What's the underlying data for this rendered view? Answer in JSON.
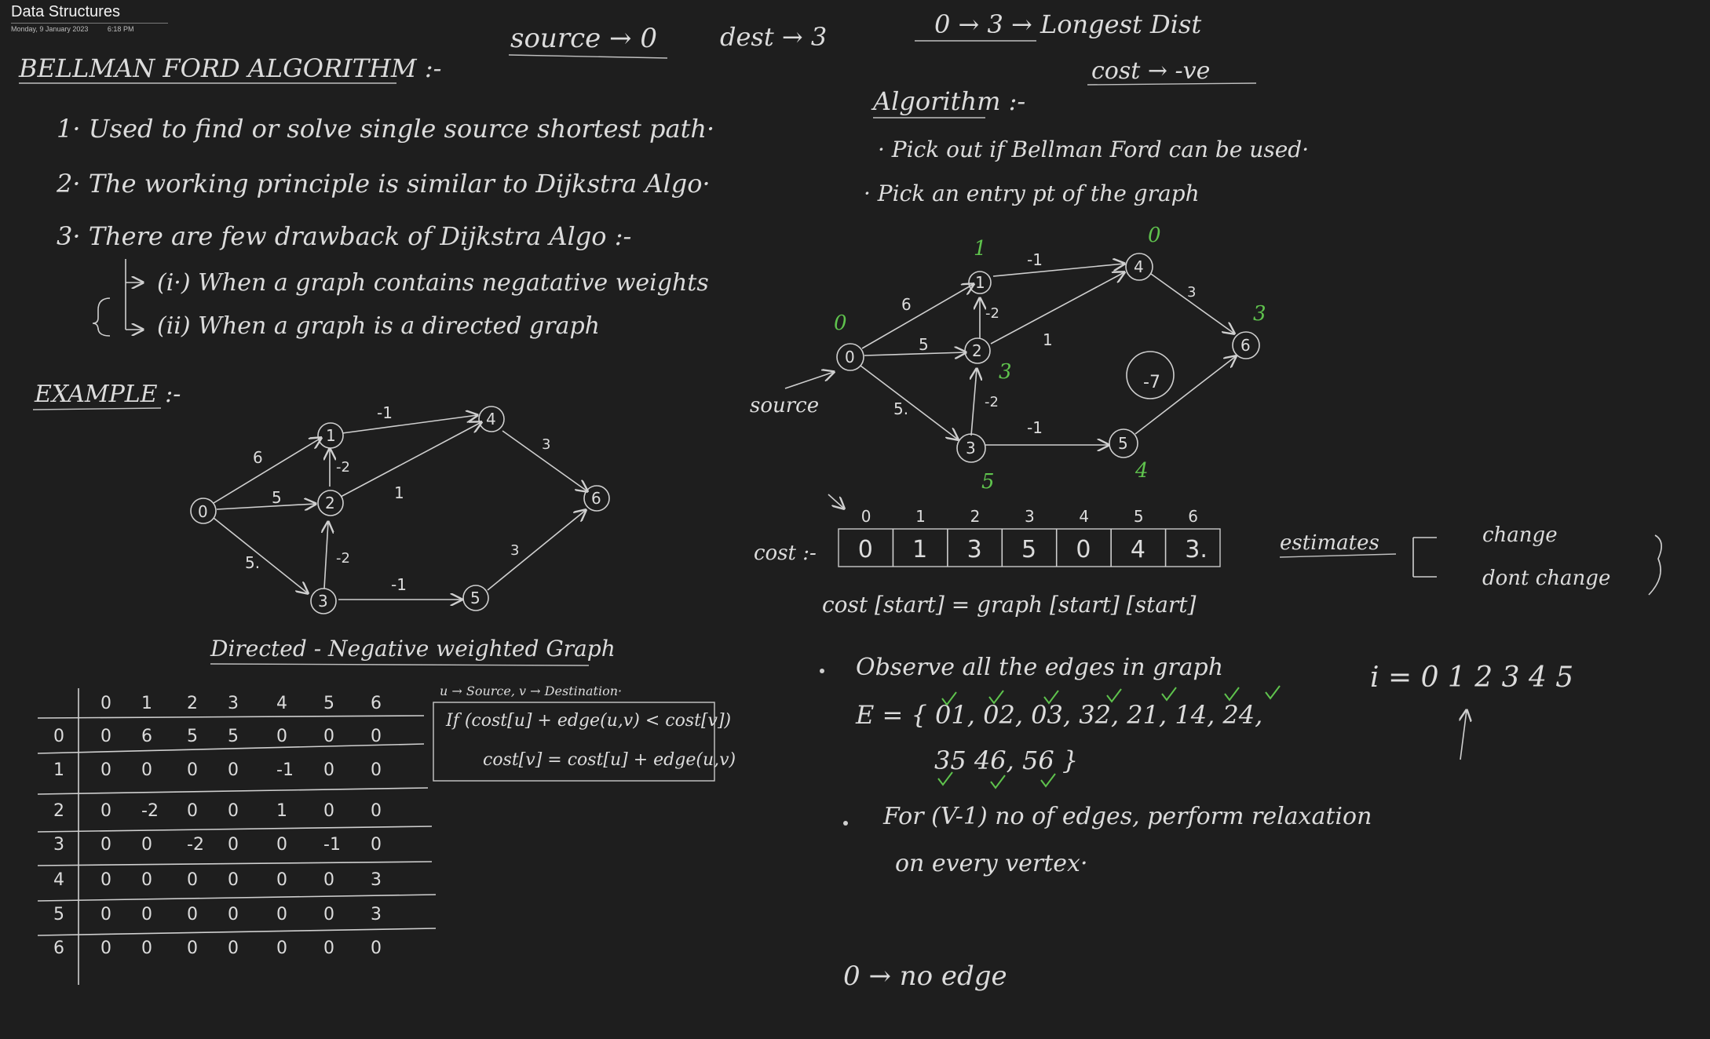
{
  "header": {
    "title": "Data Structures",
    "date": "Monday, 9 January 2023",
    "time": "6:18 PM"
  },
  "top": {
    "source": "source → 0",
    "dest": "dest → 3",
    "longest": "0 → 3 → Longest Dist",
    "cost": "cost → -ve"
  },
  "left": {
    "title": "BELLMAN FORD ALGORITHM :-",
    "points": [
      "1· Used to find or solve  single  source  shortest  path·",
      "2· The working principle  is  similar  to  Dijkstra  Algo·",
      "3· There  are  few  drawback  of  Dijkstra  Algo :-"
    ],
    "sub": [
      "(i·) When  a  graph  contains  negatative  weights",
      "(ii) When  a  graph  is  a  directed  graph"
    ],
    "example": "EXAMPLE :-",
    "caption": "Directed - Negative weighted Graph"
  },
  "graph": {
    "nodes": [
      "0",
      "1",
      "2",
      "3",
      "4",
      "5",
      "6"
    ],
    "edge_labels": [
      "6",
      "5",
      "5.",
      "-1",
      "-2",
      "1",
      "-2",
      "-1",
      "3",
      "3"
    ]
  },
  "matrix": {
    "headers": [
      "0",
      "1",
      "2",
      "3",
      "4",
      "5",
      "6"
    ],
    "rows": [
      [
        "0",
        "6",
        "5",
        "5",
        "0",
        "0",
        "0"
      ],
      [
        "0",
        "0",
        "0",
        "0",
        "-1",
        "0",
        "0"
      ],
      [
        "0",
        "-2",
        "0",
        "0",
        "1",
        "0",
        "0"
      ],
      [
        "0",
        "0",
        "-2",
        "0",
        "0",
        "-1",
        "0"
      ],
      [
        "0",
        "0",
        "0",
        "0",
        "0",
        "0",
        "3"
      ],
      [
        "0",
        "0",
        "0",
        "0",
        "0",
        "0",
        "3"
      ],
      [
        "0",
        "0",
        "0",
        "0",
        "0",
        "0",
        "0"
      ]
    ]
  },
  "relax": {
    "legend": "u → Source,   v → Destination·",
    "cond": "If (cost[u] + edge(u,v)  <  cost[v])",
    "update": "cost[v] = cost[u] + edge(u,v)"
  },
  "right": {
    "algo_title": "Algorithm :-",
    "algo": [
      "· Pick out if  Bellman Ford  can be  used·",
      "· Pick  an  entry  pt  of  the  graph"
    ],
    "source_label": "source",
    "green_costs": [
      "0",
      "1",
      "3",
      "5",
      "0",
      "4",
      "3"
    ],
    "neg7": "-7",
    "cost_label": "cost :-",
    "cost_idx": [
      "0",
      "1",
      "2",
      "3",
      "4",
      "5",
      "6"
    ],
    "cost_vals": [
      "0",
      "1",
      "3",
      "5",
      "0",
      "4",
      "3."
    ],
    "cost_formula": "cost [start]  =  graph [start] [start]",
    "estimates": "estimates",
    "change": "change",
    "dont_change": "dont change",
    "observe": "Observe  all  the  edges  in  graph",
    "edges_line1": "E = { 01,  02,  03,  32,  21,  14,  24,",
    "edges_line2": "35   46,   56 }",
    "i_line": "i =  0  1   2  3  4  5",
    "relax_line1": "For  (V-1)  no  of  edges,  perform  relaxation",
    "relax_line2": "on  every  vertex·",
    "no_edge": "0 → no edge"
  }
}
